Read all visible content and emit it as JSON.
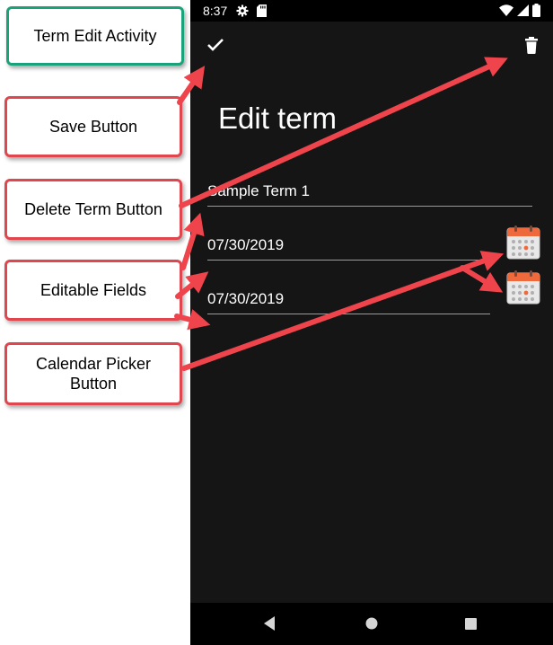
{
  "status_bar": {
    "time": "8:37",
    "icons": [
      "gear-icon",
      "sd-card-icon",
      "wifi-icon",
      "signal-icon",
      "battery-icon"
    ]
  },
  "toolbar": {
    "save_icon": "check-icon",
    "delete_icon": "trash-icon"
  },
  "page": {
    "title": "Edit term"
  },
  "fields": {
    "term_title": "Sample Term 1",
    "start_date": "07/30/2019",
    "end_date": "07/30/2019"
  },
  "nav_bar": {
    "icons": [
      "back-icon",
      "home-icon",
      "recents-icon"
    ]
  },
  "callouts": {
    "activity": "Term Edit Activity",
    "save": "Save Button",
    "delete": "Delete Term Button",
    "fields": "Editable Fields",
    "calendar": "Calendar Picker Button"
  },
  "colors": {
    "screen_background": "#151515",
    "annotation_arrow": "#f0444c",
    "callout_green_border": "#1aa37a",
    "callout_red_border": "#e0464e",
    "calendar_header": "#ee6a3c"
  }
}
